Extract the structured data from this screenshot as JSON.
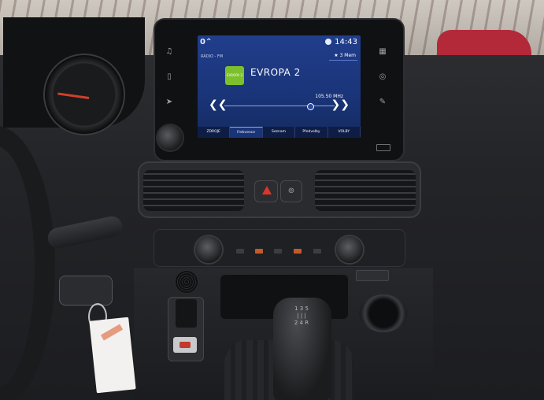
{
  "infotainment": {
    "logo": "0⌃",
    "clock": "14:43",
    "band": "RÁDIO - FM",
    "favorite": "3 Mem",
    "station_logo_text": "EVROPA 2",
    "station": "EVROPA 2",
    "frequency": "105.50 MHz",
    "prev_symbol": "❮❮",
    "next_symbol": "❯❯",
    "tabs": [
      {
        "label": "ZDROJE"
      },
      {
        "label": "Frekvence"
      },
      {
        "label": "Seznam"
      },
      {
        "label": "Předvolby"
      },
      {
        "label": "VOLBY"
      }
    ],
    "slider_fraction": 0.78
  },
  "shifter": {
    "pattern": "1 3 5\n| | |\n2 4 R"
  },
  "colors": {
    "screen_blue": "#1a3478",
    "hazard_red": "#d8372a",
    "station_green": "#7cc12d"
  }
}
